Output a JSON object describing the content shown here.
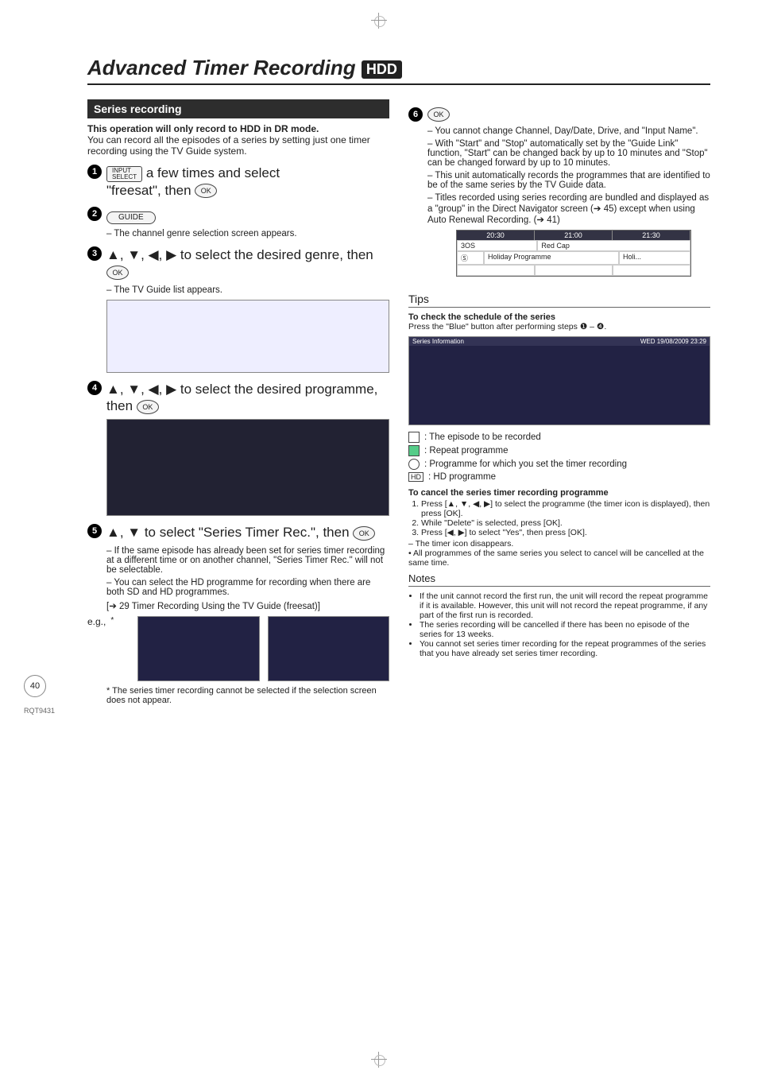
{
  "title": "Advanced Timer Recording",
  "badge": "HDD",
  "pageNumber": "40",
  "docCode": "RQT9431",
  "section": {
    "header": "Series recording",
    "intro_bold": "This operation will only record to HDD in DR mode.",
    "intro_text": "You can record all the episodes of a series by setting just one timer recording using the TV Guide system."
  },
  "steps": {
    "s1a": "a few times and select",
    "s1b": "\"freesat\", then",
    "input_btn_top": "INPUT",
    "input_btn_bot": "SELECT",
    "ok_label": "OK",
    "s2_btn": "GUIDE",
    "s2_note": "– The channel genre selection screen appears.",
    "s3": "to select the desired genre, then",
    "s3_note": "– The TV Guide list appears.",
    "s4": "to select the desired programme, then",
    "s5": "to select \"Series Timer Rec.\", then",
    "s5_n1": "– If the same episode has already been set for series timer recording at a different time or on another channel, \"Series Timer Rec.\" will not be selectable.",
    "s5_n2": "– You can select the HD programme for recording when there are both SD and HD programmes.",
    "s5_n3": "[➔ 29 Timer Recording Using the TV Guide (freesat)]",
    "eg_label": "e.g.,",
    "footnote": "* The series timer recording cannot be selected if the selection screen does not appear."
  },
  "right": {
    "s6_n1": "– You cannot change Channel, Day/Date, Drive, and \"Input Name\".",
    "s6_n2": "– With \"Start\" and \"Stop\" automatically set by the \"Guide Link\" function, \"Start\" can be changed back by up to 10 minutes and \"Stop\" can be changed forward by up to 10 minutes.",
    "s6_n3": "– This unit automatically records the programmes that are identified to be of the same series by the TV Guide data.",
    "s6_n4": "– Titles recorded using series recording are bundled and displayed as a \"group\" in the Direct Navigator screen (➔ 45) except when using Auto Renewal Recording. (➔ 41)",
    "grid_times": [
      "20:30",
      "21:00",
      "21:30"
    ],
    "grid_row1_a": "3OS",
    "grid_row1_b": "Red Cap",
    "grid_row2_a": "Holiday Programme",
    "grid_row2_b": "Holi..."
  },
  "tips": {
    "title": "Tips",
    "sub": "To check the schedule of the series",
    "line": "Press the \"Blue\" button after performing steps",
    "range": "❶ – ❹.",
    "table_title": "Series Information",
    "table_date": "WED 19/08/2009 23:29",
    "legend1": ": The episode to be recorded",
    "legend2": ": Repeat programme",
    "legend3": ": Programme for which you set the timer recording",
    "legend4_badge": "HD",
    "legend4": ": HD programme",
    "cancel_title": "To cancel the series timer recording programme",
    "cancel_1": "Press [▲, ▼, ◀, ▶] to select the programme (the timer icon is displayed), then press [OK].",
    "cancel_2": "While \"Delete\" is selected, press [OK].",
    "cancel_3": "Press [◀, ▶] to select \"Yes\", then press [OK].",
    "cancel_n1": "– The timer icon disappears.",
    "cancel_n2": "• All programmes of the same series you select to cancel will be cancelled at the same time."
  },
  "notes": {
    "title": "Notes",
    "n1": "If the unit cannot record the first run, the unit will record the repeat programme if it is available. However, this unit will not record the repeat programme, if any part of the first run is recorded.",
    "n2": "The series recording will be cancelled if there has been no episode of the series for 13 weeks.",
    "n3": "You cannot set series timer recording for the repeat programmes of the series that you have already set series timer recording."
  }
}
